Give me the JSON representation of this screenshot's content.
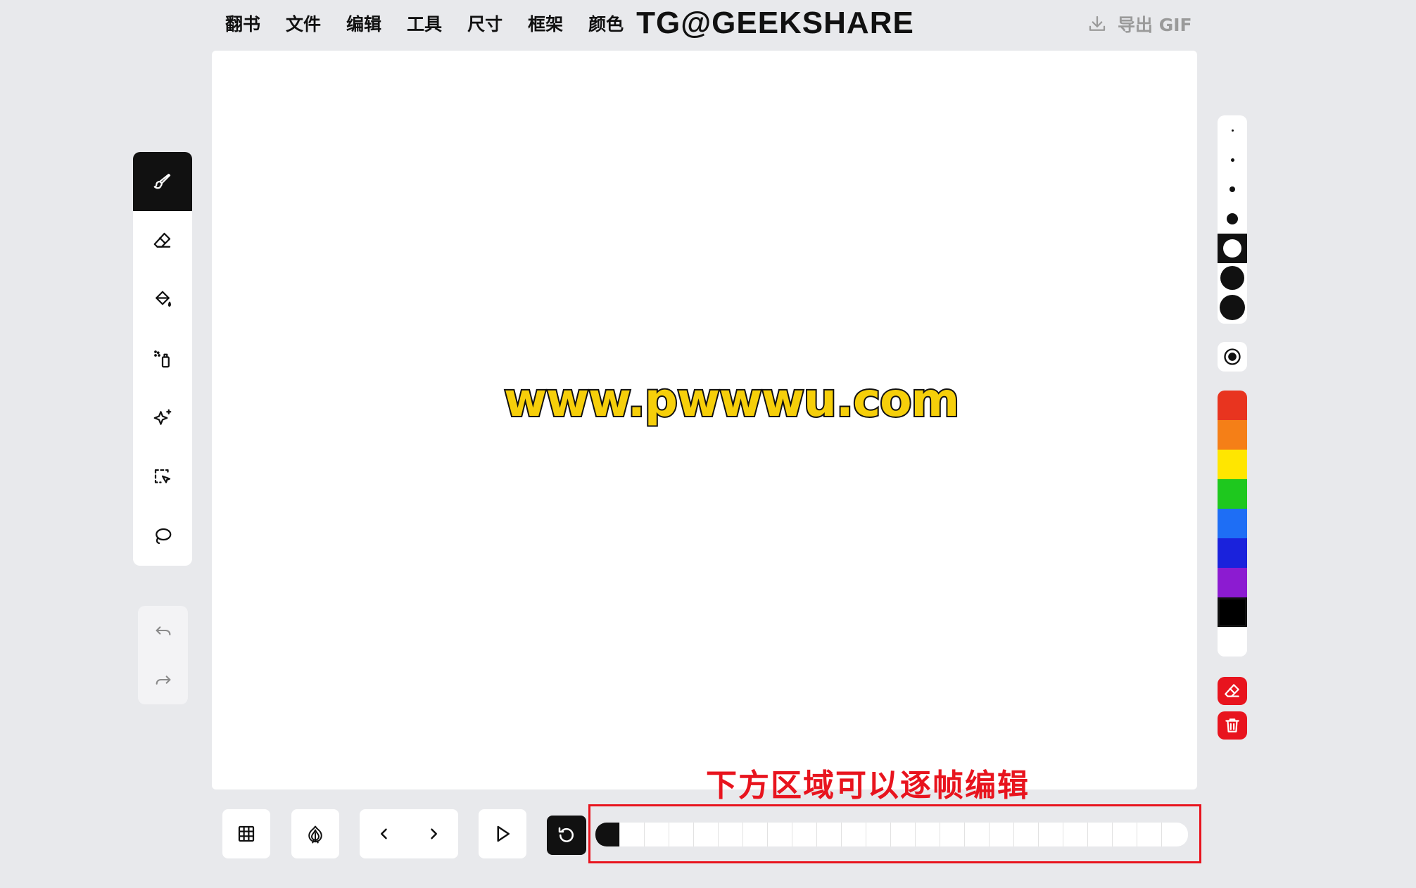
{
  "menu": {
    "items": [
      "翻书",
      "文件",
      "编辑",
      "工具",
      "尺寸",
      "框架",
      "颜色"
    ],
    "watermark": "TG@GEEKSHARE"
  },
  "export": {
    "label": "导出 GIF",
    "icon": "download-icon"
  },
  "canvas": {
    "watermark": "www.pwwwu.com"
  },
  "tools": [
    {
      "name": "brush",
      "icon": "brush-icon",
      "active": true
    },
    {
      "name": "eraser",
      "icon": "eraser-icon"
    },
    {
      "name": "fill",
      "icon": "paint-bucket-icon"
    },
    {
      "name": "spray",
      "icon": "spray-can-icon"
    },
    {
      "name": "magic",
      "icon": "sparkles-icon"
    },
    {
      "name": "select",
      "icon": "select-cursor-icon"
    },
    {
      "name": "lasso",
      "icon": "lasso-icon"
    }
  ],
  "history": [
    {
      "name": "undo",
      "icon": "undo-icon"
    },
    {
      "name": "redo",
      "icon": "redo-icon"
    }
  ],
  "brush_sizes": {
    "count": 7,
    "selected_index": 4
  },
  "palette": {
    "colors": [
      "#e8341f",
      "#f57f17",
      "#ffe600",
      "#1ec81e",
      "#1e6ef5",
      "#1a22dc",
      "#8c1bd1",
      "#000000",
      "#ffffff"
    ],
    "selected_index": 7
  },
  "actions": [
    {
      "name": "clear-frame",
      "icon": "eraser-icon"
    },
    {
      "name": "delete",
      "icon": "trash-icon"
    }
  ],
  "bottom": {
    "buttons": [
      {
        "name": "grid",
        "icon": "grid-icon"
      },
      {
        "name": "onion-skin",
        "icon": "onion-icon"
      },
      {
        "name": "prev-frame",
        "icon": "chevron-left-icon"
      },
      {
        "name": "next-frame",
        "icon": "chevron-right-icon"
      },
      {
        "name": "play",
        "icon": "play-icon"
      },
      {
        "name": "loop",
        "icon": "loop-icon"
      }
    ],
    "frames": {
      "count": 24,
      "current_index": 0
    }
  },
  "annotation": {
    "text": "下方区域可以逐帧编辑",
    "color": "#e8141e"
  }
}
